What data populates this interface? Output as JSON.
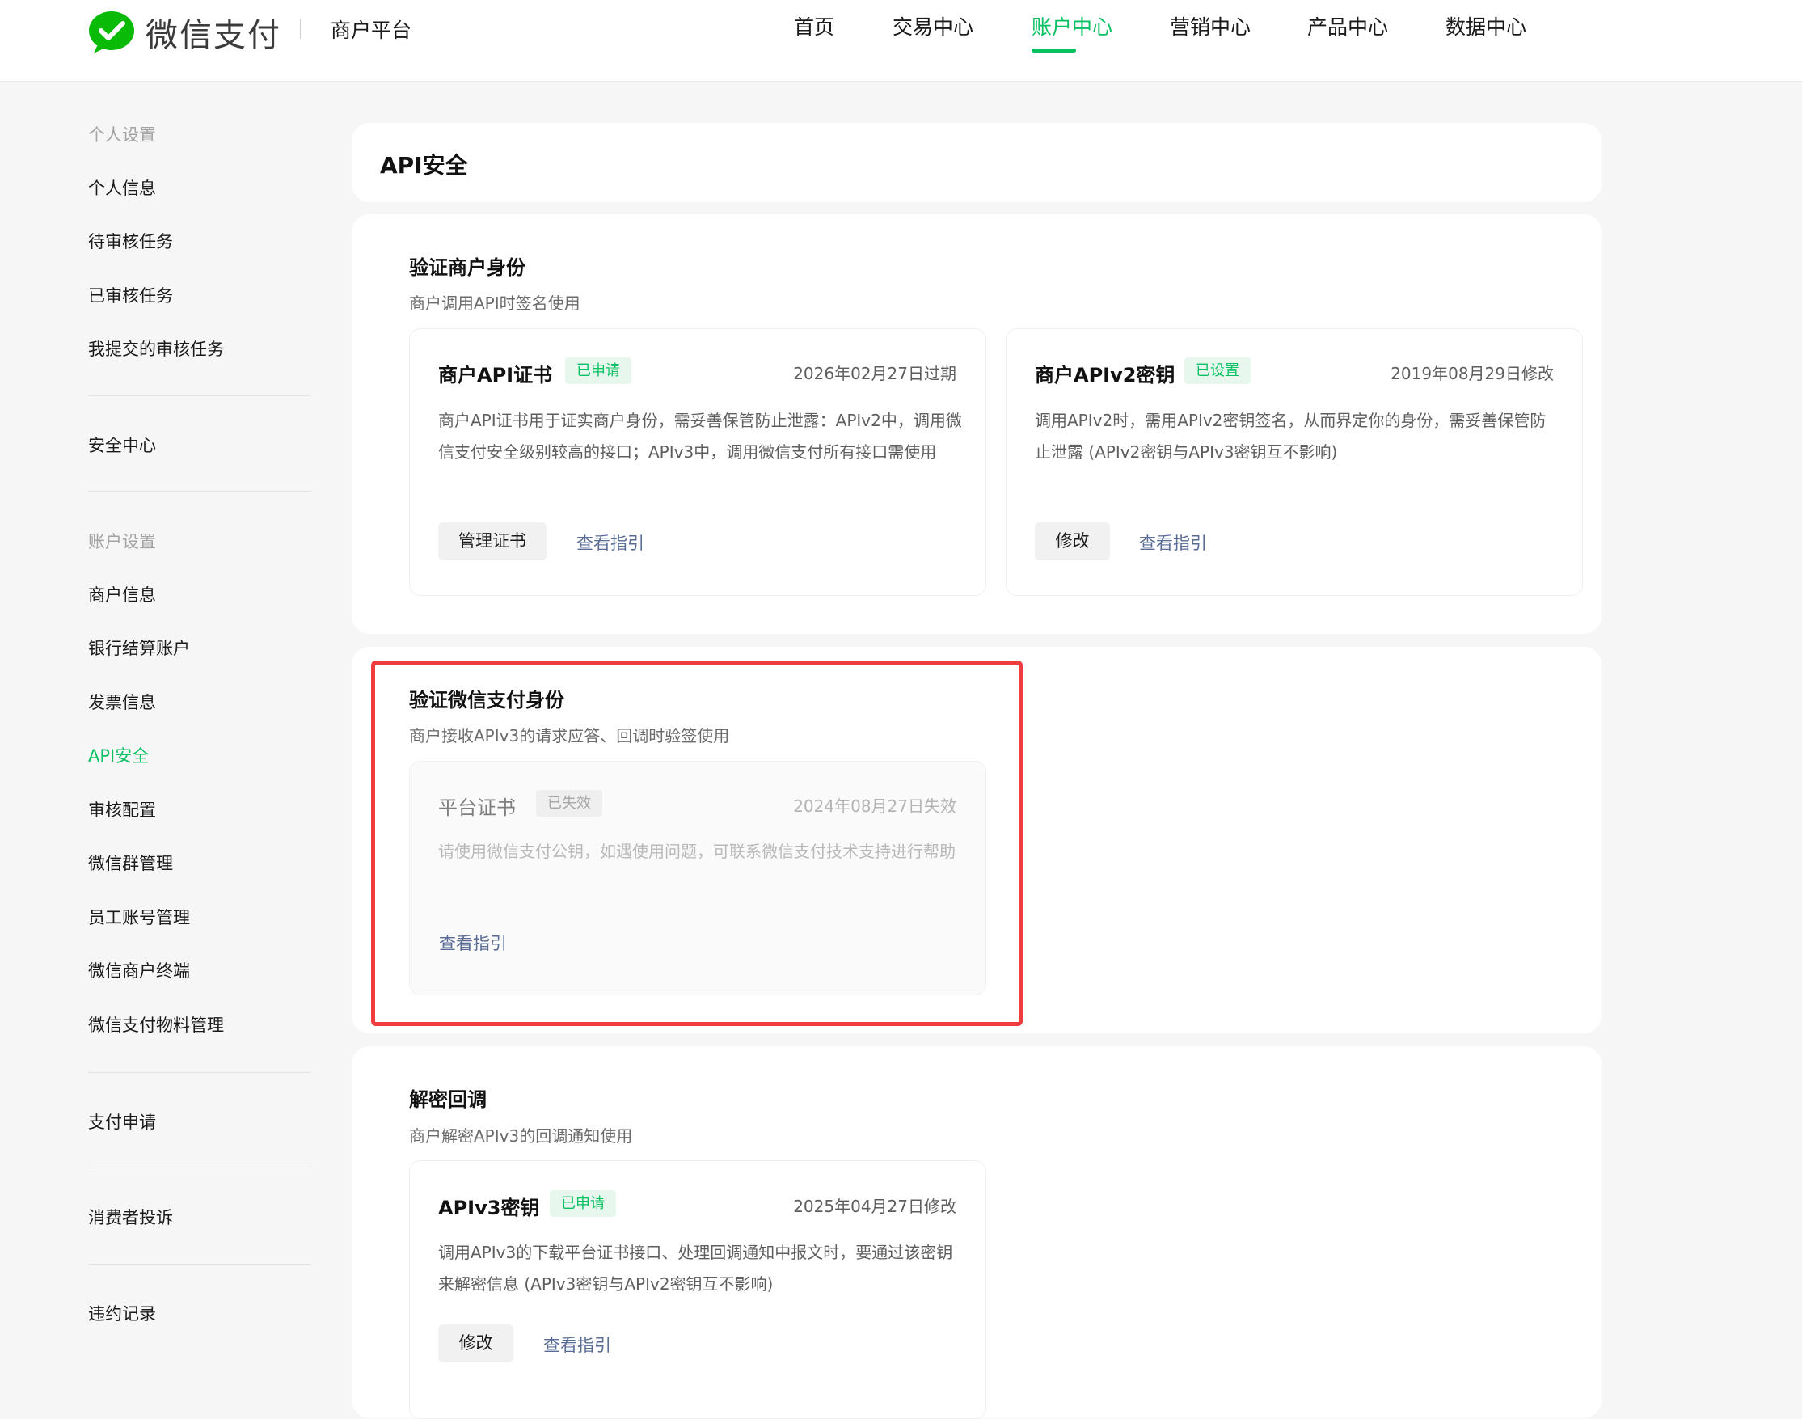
{
  "header": {
    "logo_text": "微信支付",
    "platform": "商户平台",
    "nav": [
      {
        "label": "首页"
      },
      {
        "label": "交易中心"
      },
      {
        "label": "账户中心"
      },
      {
        "label": "营销中心"
      },
      {
        "label": "产品中心"
      },
      {
        "label": "数据中心"
      }
    ],
    "active_nav": "账户中心"
  },
  "sidebar": {
    "groups": [
      {
        "label": "个人设置"
      },
      {
        "label": "账户设置"
      }
    ],
    "items": [
      {
        "label": "个人信息"
      },
      {
        "label": "待审核任务"
      },
      {
        "label": "已审核任务"
      },
      {
        "label": "我提交的审核任务"
      },
      {
        "label": "安全中心"
      },
      {
        "label": "商户信息"
      },
      {
        "label": "银行结算账户"
      },
      {
        "label": "发票信息"
      },
      {
        "label": "API安全"
      },
      {
        "label": "审核配置"
      },
      {
        "label": "微信群管理"
      },
      {
        "label": "员工账号管理"
      },
      {
        "label": "微信商户终端"
      },
      {
        "label": "微信支付物料管理"
      },
      {
        "label": "支付申请"
      },
      {
        "label": "消费者投诉"
      },
      {
        "label": "违约记录"
      }
    ],
    "active_item": "API安全"
  },
  "main": {
    "page_title": "API安全",
    "sections": [
      {
        "title": "验证商户身份",
        "subtitle": "商户调用API时签名使用",
        "cards": [
          {
            "title": "商户API证书",
            "badge": "已申请",
            "date": "2026年02月27日过期",
            "desc": "商户API证书用于证实商户身份，需妥善保管防止泄露：APIv2中，调用微信支付安全级别较高的接口；APIv3中，调用微信支付所有接口需使用",
            "button": "管理证书",
            "link": "查看指引"
          },
          {
            "title": "商户APIv2密钥",
            "badge": "已设置",
            "date": "2019年08月29日修改",
            "desc": "调用APIv2时，需用APIv2密钥签名，从而界定你的身份，需妥善保管防止泄露 (APIv2密钥与APIv3密钥互不影响)",
            "button": "修改",
            "link": "查看指引"
          }
        ]
      },
      {
        "title": "验证微信支付身份",
        "subtitle": "商户接收APIv3的请求应答、回调时验签使用",
        "cards": [
          {
            "title": "平台证书",
            "badge": "已失效",
            "date": "2024年08月27日失效",
            "desc": "请使用微信支付公钥，如遇使用问题，可联系微信支付技术支持进行帮助",
            "link": "查看指引"
          }
        ]
      },
      {
        "title": "解密回调",
        "subtitle": "商户解密APIv3的回调通知使用",
        "cards": [
          {
            "title": "APIv3密钥",
            "badge": "已申请",
            "date": "2025年04月27日修改",
            "desc": "调用APIv3的下载平台证书接口、处理回调通知中报文时，要通过该密钥来解密信息 (APIv3密钥与APIv2密钥互不影响)",
            "button": "修改",
            "link": "查看指引"
          }
        ]
      }
    ]
  },
  "colors": {
    "brand": "#07c160",
    "link": "#576b95",
    "highlight": "#ee3c3f"
  }
}
